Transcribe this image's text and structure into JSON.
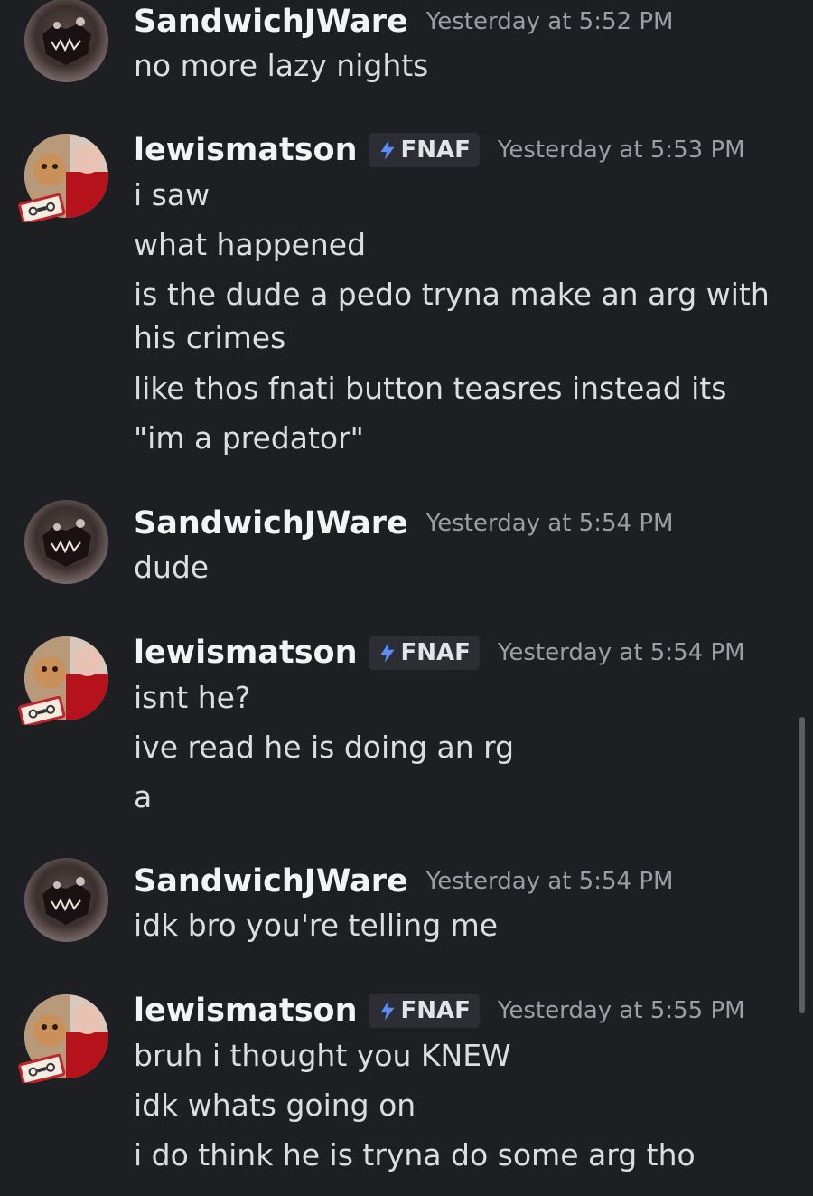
{
  "users": {
    "sandwich": {
      "name": "SandwichJWare"
    },
    "lewis": {
      "name": "lewismatson",
      "tag": "FNAF"
    }
  },
  "messages": [
    {
      "author": "SandwichJWare",
      "timestamp": "Yesterday at 5:52 PM",
      "lines": [
        "no more lazy nights"
      ]
    },
    {
      "author": "lewismatson",
      "tag": "FNAF",
      "timestamp": "Yesterday at 5:53 PM",
      "lines": [
        "i saw",
        "what happened",
        "is the dude a pedo tryna make an arg with his crimes",
        "like thos fnati button teasres instead its",
        "\"im a predator\""
      ]
    },
    {
      "author": "SandwichJWare",
      "timestamp": "Yesterday at 5:54 PM",
      "lines": [
        "dude"
      ]
    },
    {
      "author": "lewismatson",
      "tag": "FNAF",
      "timestamp": "Yesterday at 5:54 PM",
      "lines": [
        "isnt he?",
        "ive read he is doing an rg",
        "a"
      ]
    },
    {
      "author": "SandwichJWare",
      "timestamp": "Yesterday at 5:54 PM",
      "lines": [
        "idk bro you're telling me"
      ]
    },
    {
      "author": "lewismatson",
      "tag": "FNAF",
      "timestamp": "Yesterday at 5:55 PM",
      "lines": [
        "bruh i thought you KNEW",
        "idk whats going on",
        "i do think he is tryna do some arg tho"
      ]
    }
  ],
  "icons": {
    "tag_icon": "lightning-bolt-icon",
    "avatar_decoration": "cassette-tape-icon"
  },
  "colors": {
    "background": "#1e1f22",
    "username": "#f2f3f5",
    "timestamp": "#9b9ea6",
    "text": "#dcdde1",
    "tag_bg": "#2c2e33",
    "tag_icon": "#5c8df6"
  }
}
